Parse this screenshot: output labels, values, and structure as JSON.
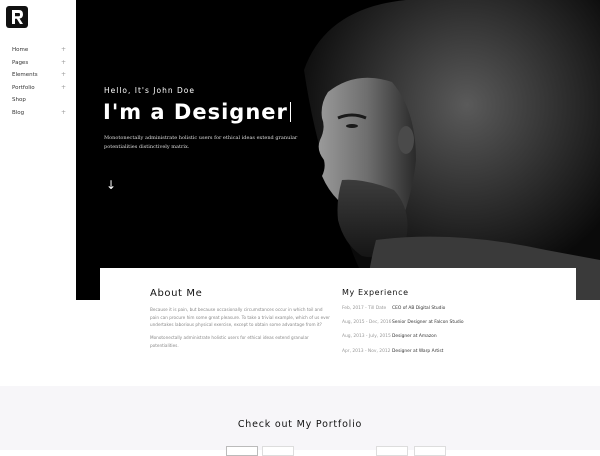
{
  "brand": {
    "logo_icon": "brand-r-logo-icon"
  },
  "sidebar": {
    "items": [
      {
        "label": "Home",
        "has_submenu": true
      },
      {
        "label": "Pages",
        "has_submenu": true
      },
      {
        "label": "Elements",
        "has_submenu": true
      },
      {
        "label": "Portfolio",
        "has_submenu": true
      },
      {
        "label": "Shop",
        "has_submenu": false
      },
      {
        "label": "Blog",
        "has_submenu": true
      }
    ],
    "plus_glyph": "+"
  },
  "hero": {
    "greeting": "Hello, It's John Doe",
    "title": "I'm a Designer",
    "description": "Monotonectally administrate holistic users for ethical ideas extend granular potentialities distinctively matrix.",
    "scroll_icon": "arrow-down-icon",
    "arrow_glyph": "↓"
  },
  "about": {
    "title": "About Me",
    "paragraph1": "Because it is pain, but because occasionally circumstances occur in which toil and pain can procure him some great pleasure. To take a trivial example, which of us ever undertakes laborious physical exercise, except to obtain some advantage from it?",
    "paragraph2": "Monotonectally administrate holistic users for ethical ideas extend granular potentialities."
  },
  "experience": {
    "title": "My Experience",
    "items": [
      {
        "date": "Feb, 2017 - Till Date",
        "role": "CEO of AB Digital Studio"
      },
      {
        "date": "Aug, 2015 - Dec, 2016",
        "role": "Senior Designer at Falcon Studio"
      },
      {
        "date": "Aug, 2013 - July, 2015",
        "role": "Designer at Amazon"
      },
      {
        "date": "Apr, 2013 - Nov, 2012",
        "role": "Designer at Warp Artist"
      }
    ]
  },
  "portfolio": {
    "title": "Check out My Portfolio"
  },
  "colors": {
    "hero_bg": "#000000",
    "portfolio_bg": "#f7f6f9",
    "text_dark": "#111111",
    "text_muted": "#888888"
  }
}
